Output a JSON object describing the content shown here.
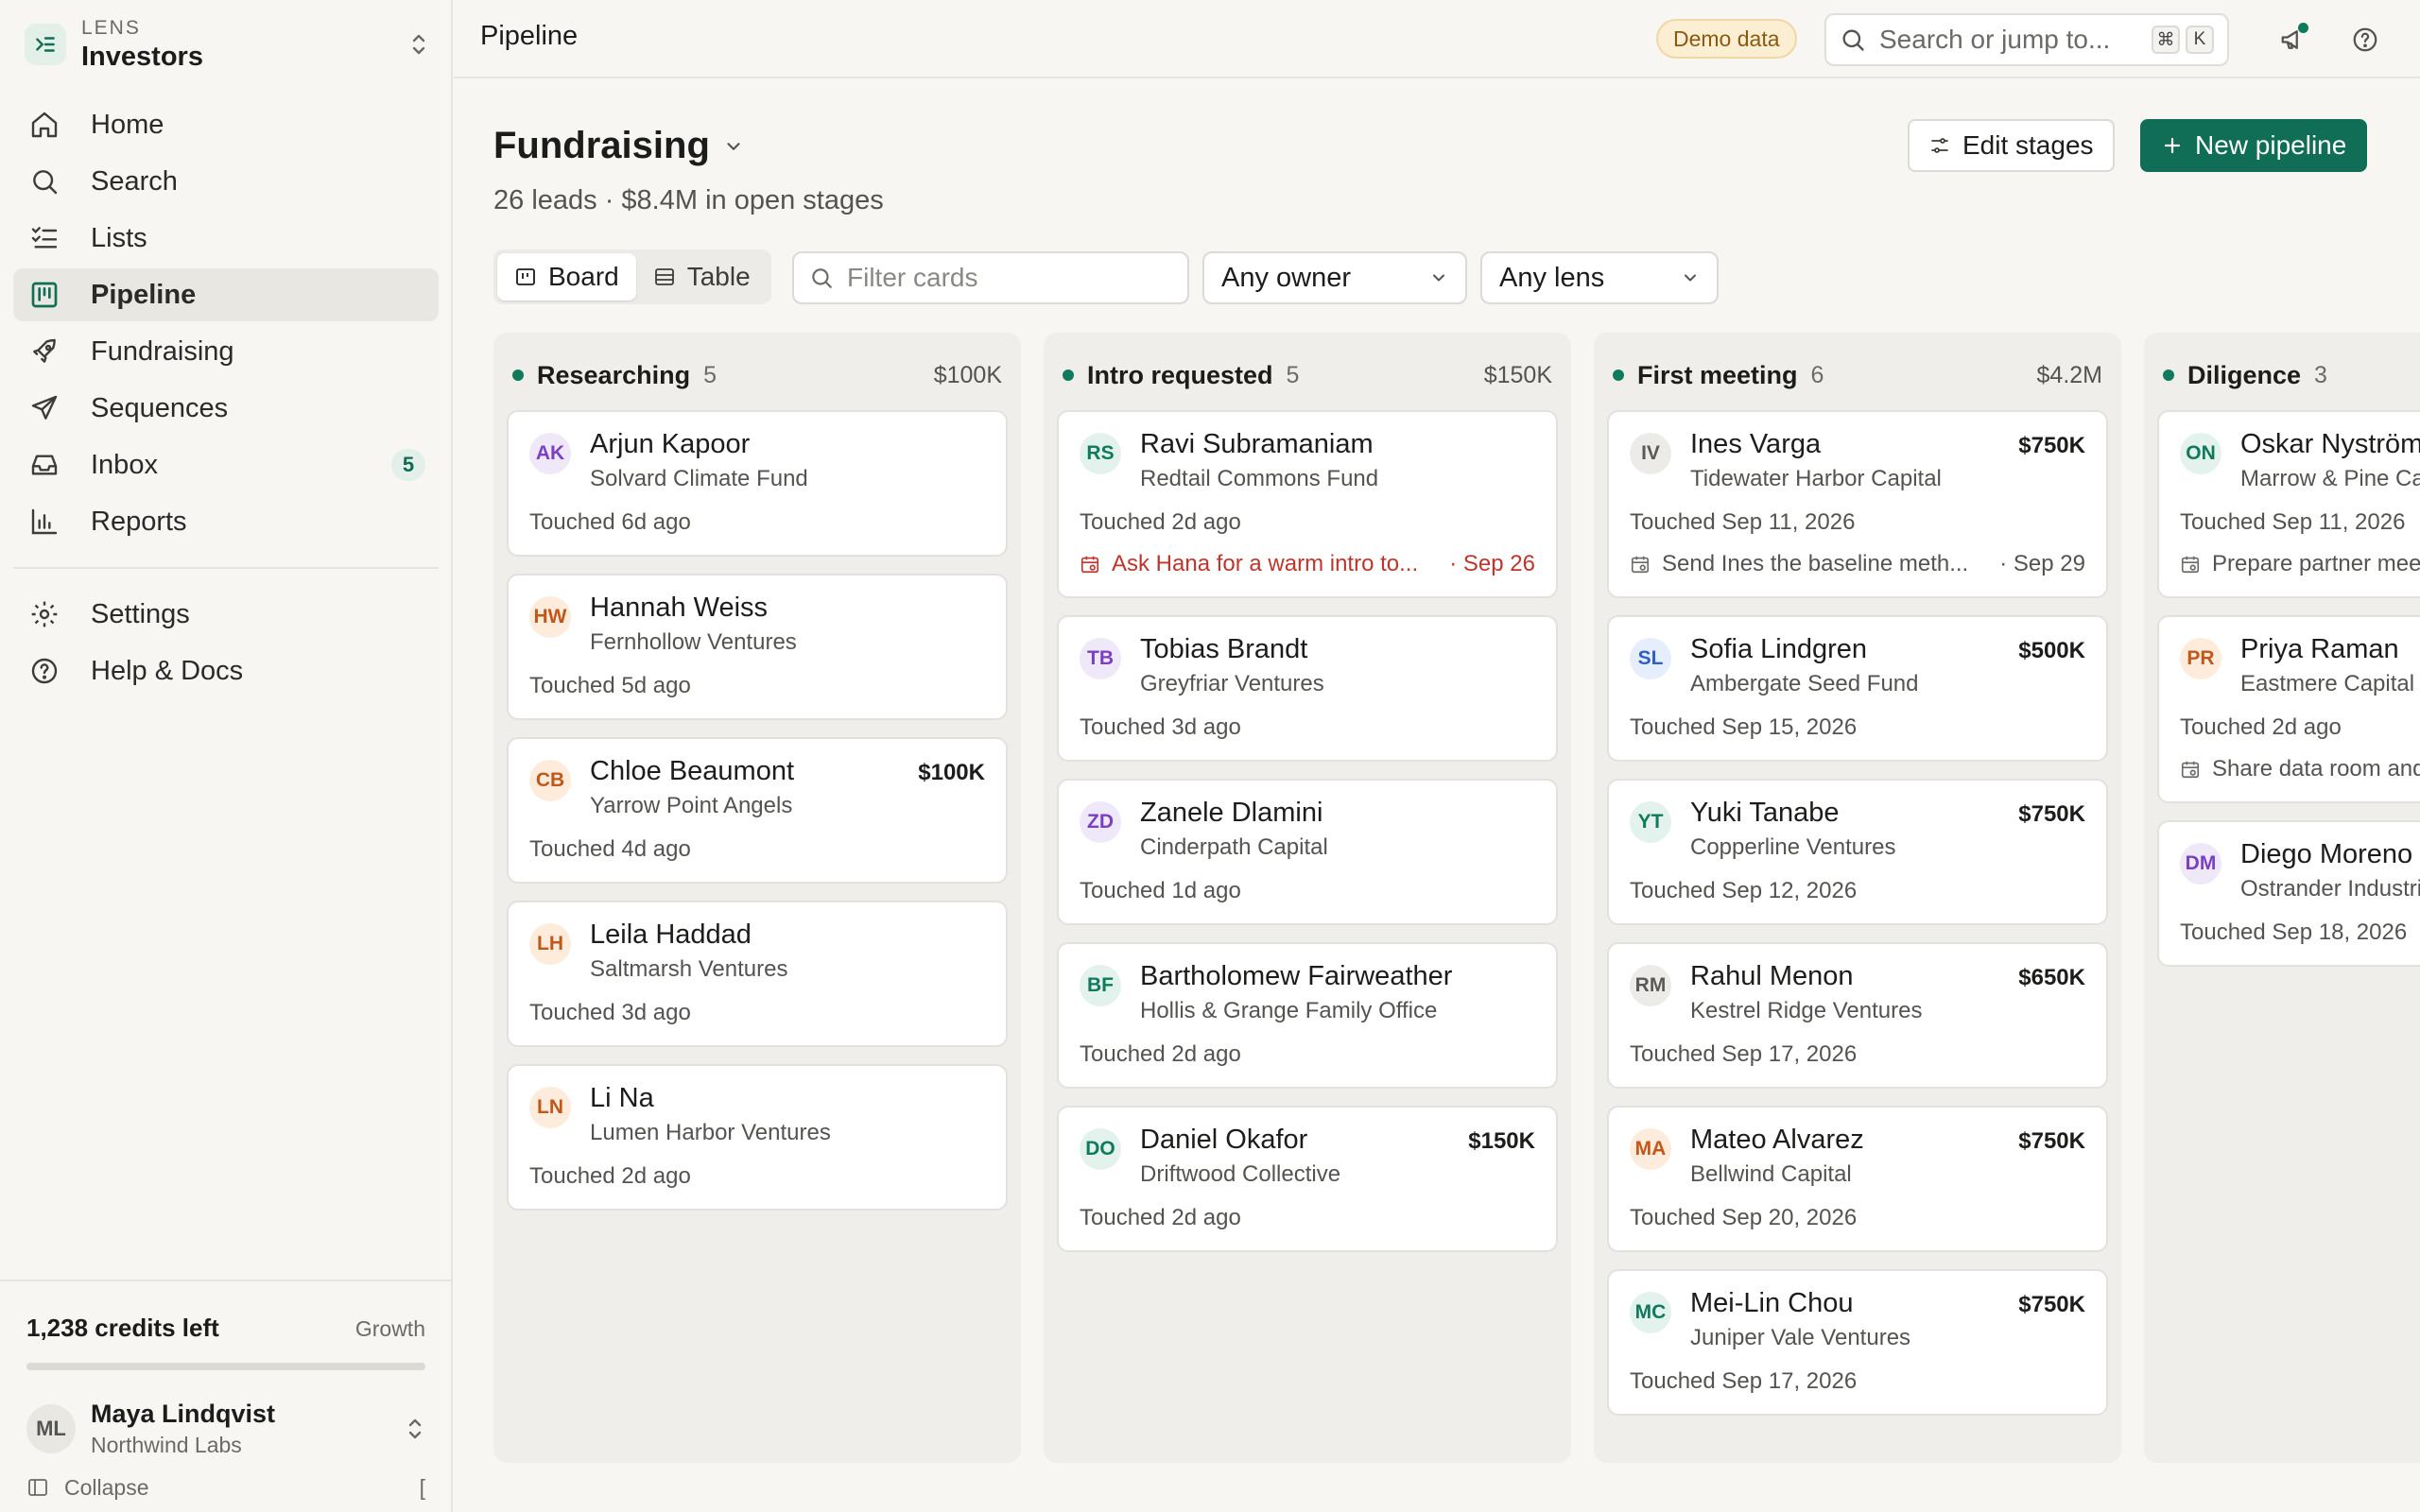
{
  "brand": {
    "kicker": "LENS",
    "name": "Investors"
  },
  "sidebar": {
    "items": [
      {
        "label": "Home",
        "icon": "home-icon"
      },
      {
        "label": "Search",
        "icon": "search-icon"
      },
      {
        "label": "Lists",
        "icon": "list-icon"
      },
      {
        "label": "Pipeline",
        "icon": "pipeline-icon",
        "active": true
      },
      {
        "label": "Fundraising",
        "icon": "rocket-icon"
      },
      {
        "label": "Sequences",
        "icon": "send-icon"
      },
      {
        "label": "Inbox",
        "icon": "inbox-icon",
        "badge": "5"
      },
      {
        "label": "Reports",
        "icon": "bar-chart-icon"
      }
    ],
    "secondary": [
      {
        "label": "Settings",
        "icon": "gear-icon"
      },
      {
        "label": "Help & Docs",
        "icon": "help-icon"
      }
    ],
    "credits": {
      "count": "1,238 credits left",
      "plan": "Growth"
    },
    "user": {
      "initials": "ML",
      "name": "Maya Lindqvist",
      "org": "Northwind Labs"
    },
    "collapse": {
      "label": "Collapse",
      "shortcut": "["
    }
  },
  "topbar": {
    "crumb": "Pipeline",
    "demo_badge": "Demo data",
    "search_placeholder": "Search or jump to...",
    "kbd": [
      "⌘",
      "K"
    ]
  },
  "pipeline": {
    "title": "Fundraising",
    "subtitle": "26 leads · $8.4M in open stages",
    "edit_label": "Edit stages",
    "new_label": "New pipeline",
    "views": [
      "Board",
      "Table"
    ],
    "filter_placeholder": "Filter cards",
    "owner_select": "Any owner",
    "lens_select": "Any lens"
  },
  "columns": [
    {
      "name": "Researching",
      "count": "5",
      "total": "$100K",
      "cards": [
        {
          "initials": "AK",
          "name": "Arjun Kapoor",
          "org": "Solvard Climate Fund",
          "amount": "",
          "touched": "Touched 6d ago",
          "av_bg": "#efe8f8",
          "av_fg": "#7b3fc4"
        },
        {
          "initials": "HW",
          "name": "Hannah Weiss",
          "org": "Fernhollow Ventures",
          "amount": "",
          "touched": "Touched 5d ago",
          "av_bg": "#fdecdc",
          "av_fg": "#c2571a"
        },
        {
          "initials": "CB",
          "name": "Chloe Beaumont",
          "org": "Yarrow Point Angels",
          "amount": "$100K",
          "touched": "Touched 4d ago",
          "av_bg": "#fdecdc",
          "av_fg": "#c2571a"
        },
        {
          "initials": "LH",
          "name": "Leila Haddad",
          "org": "Saltmarsh Ventures",
          "amount": "",
          "touched": "Touched 3d ago",
          "av_bg": "#fdecdc",
          "av_fg": "#c2571a"
        },
        {
          "initials": "LN",
          "name": "Li Na",
          "org": "Lumen Harbor Ventures",
          "amount": "",
          "touched": "Touched 2d ago",
          "av_bg": "#fdecdc",
          "av_fg": "#c2571a"
        }
      ]
    },
    {
      "name": "Intro requested",
      "count": "5",
      "total": "$150K",
      "cards": [
        {
          "initials": "RS",
          "name": "Ravi Subramaniam",
          "org": "Redtail Commons Fund",
          "amount": "",
          "touched": "Touched 2d ago",
          "task": {
            "text": "Ask Hana for a warm intro to...",
            "date": "· Sep 26",
            "overdue": true
          },
          "av_bg": "#e3f2ec",
          "av_fg": "#0f7a5c"
        },
        {
          "initials": "TB",
          "name": "Tobias Brandt",
          "org": "Greyfriar Ventures",
          "amount": "",
          "touched": "Touched 3d ago",
          "av_bg": "#efe8f8",
          "av_fg": "#7b3fc4"
        },
        {
          "initials": "ZD",
          "name": "Zanele Dlamini",
          "org": "Cinderpath Capital",
          "amount": "",
          "touched": "Touched 1d ago",
          "av_bg": "#efe8f8",
          "av_fg": "#7b3fc4"
        },
        {
          "initials": "BF",
          "name": "Bartholomew Fairweather",
          "org": "Hollis & Grange Family Office",
          "amount": "",
          "touched": "Touched 2d ago",
          "av_bg": "#e3f2ec",
          "av_fg": "#0f7a5c"
        },
        {
          "initials": "DO",
          "name": "Daniel Okafor",
          "org": "Driftwood Collective",
          "amount": "$150K",
          "touched": "Touched 2d ago",
          "av_bg": "#e3f2ec",
          "av_fg": "#0f7a5c"
        }
      ]
    },
    {
      "name": "First meeting",
      "count": "6",
      "total": "$4.2M",
      "cards": [
        {
          "initials": "IV",
          "name": "Ines Varga",
          "org": "Tidewater Harbor Capital",
          "amount": "$750K",
          "touched": "Touched Sep 11, 2026",
          "task": {
            "text": "Send Ines the baseline meth...",
            "date": "· Sep 29",
            "overdue": false
          },
          "av_bg": "#ecebe8",
          "av_fg": "#5a5956"
        },
        {
          "initials": "SL",
          "name": "Sofia Lindgren",
          "org": "Ambergate Seed Fund",
          "amount": "$500K",
          "touched": "Touched Sep 15, 2026",
          "av_bg": "#e6eefb",
          "av_fg": "#2f5fc4"
        },
        {
          "initials": "YT",
          "name": "Yuki Tanabe",
          "org": "Copperline Ventures",
          "amount": "$750K",
          "touched": "Touched Sep 12, 2026",
          "av_bg": "#e3f2ec",
          "av_fg": "#0f7a5c"
        },
        {
          "initials": "RM",
          "name": "Rahul Menon",
          "org": "Kestrel Ridge Ventures",
          "amount": "$650K",
          "touched": "Touched Sep 17, 2026",
          "av_bg": "#ecebe8",
          "av_fg": "#5a5956"
        },
        {
          "initials": "MA",
          "name": "Mateo Alvarez",
          "org": "Bellwind Capital",
          "amount": "$750K",
          "touched": "Touched Sep 20, 2026",
          "av_bg": "#fdecdc",
          "av_fg": "#c2571a"
        },
        {
          "initials": "MC",
          "name": "Mei-Lin Chou",
          "org": "Juniper Vale Ventures",
          "amount": "$750K",
          "touched": "Touched Sep 17, 2026",
          "av_bg": "#e3f2ec",
          "av_fg": "#0f7a5c"
        }
      ]
    },
    {
      "name": "Diligence",
      "count": "3",
      "total": "",
      "cards": [
        {
          "initials": "ON",
          "name": "Oskar Nyström",
          "org": "Marrow & Pine Capital",
          "amount": "",
          "touched": "Touched Sep 11, 2026",
          "task": {
            "text": "Prepare partner meeting notes",
            "date": "",
            "overdue": false
          },
          "av_bg": "#e3f2ec",
          "av_fg": "#0f7a5c"
        },
        {
          "initials": "PR",
          "name": "Priya Raman",
          "org": "Eastmere Capital",
          "amount": "",
          "touched": "Touched 2d ago",
          "task": {
            "text": "Share data room and memo",
            "date": "",
            "overdue": false
          },
          "av_bg": "#fdecdc",
          "av_fg": "#c2571a"
        },
        {
          "initials": "DM",
          "name": "Diego Moreno",
          "org": "Ostrander Industries",
          "amount": "",
          "touched": "Touched Sep 18, 2026",
          "av_bg": "#efe8f8",
          "av_fg": "#7b3fc4"
        }
      ]
    }
  ],
  "colors": {
    "accent": "#0f6e55",
    "overdue": "#c0352b",
    "demo_badge_bg": "#fbeed3"
  }
}
